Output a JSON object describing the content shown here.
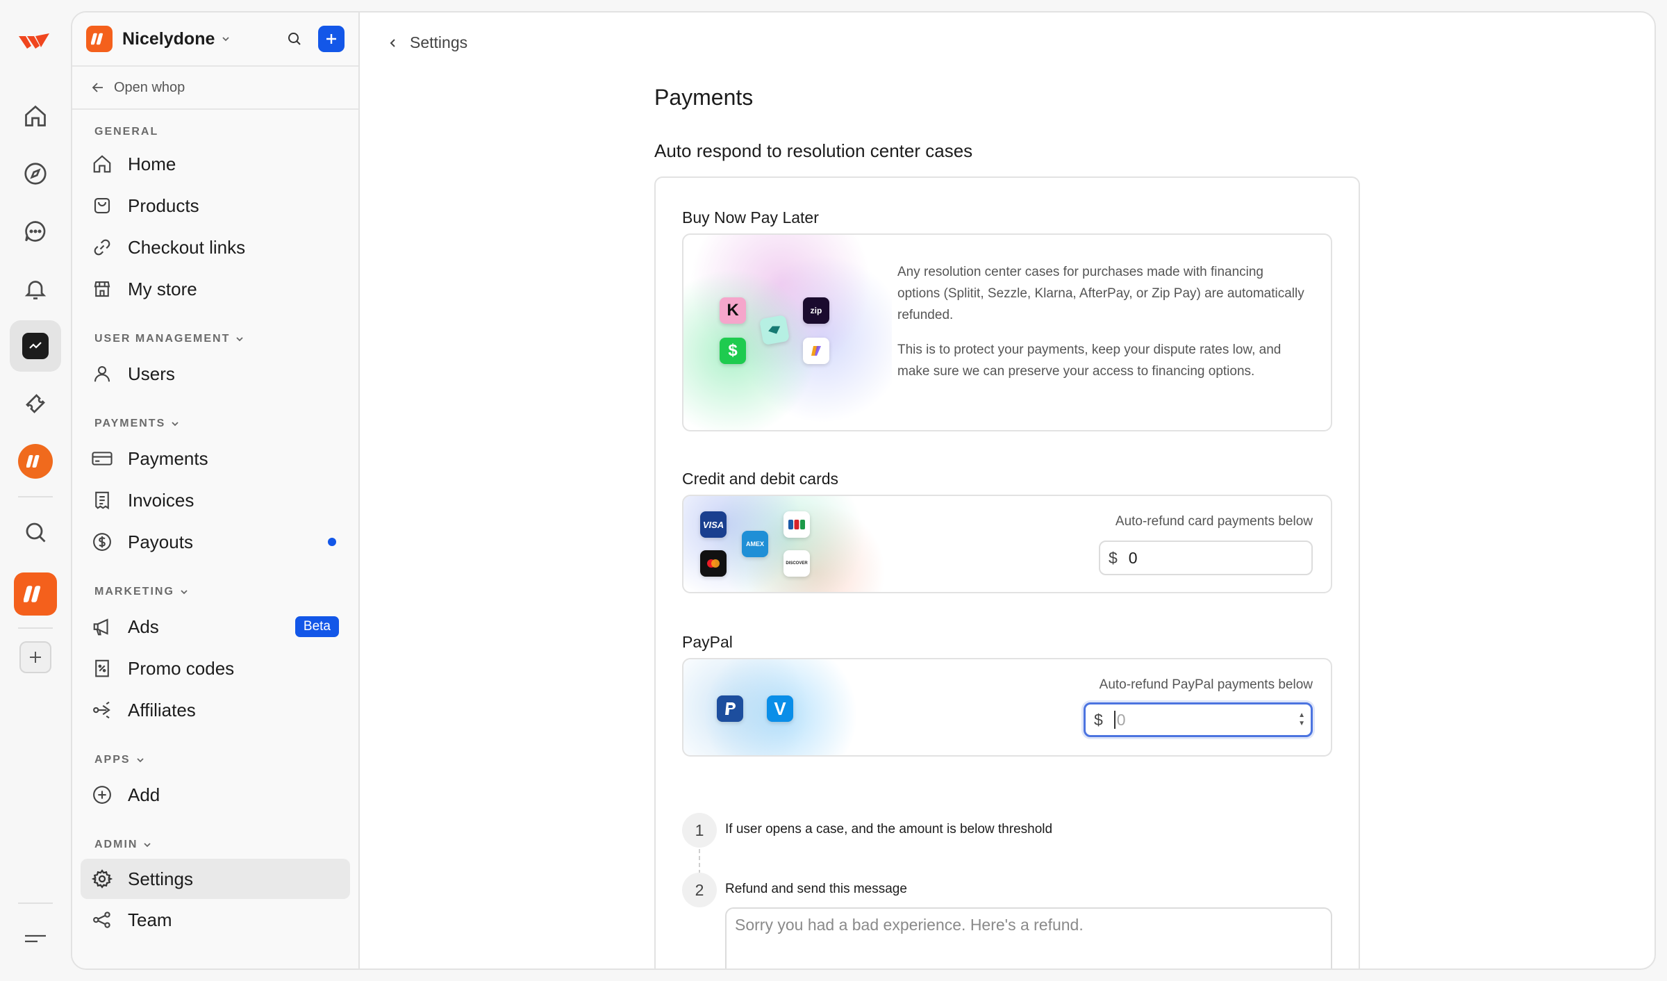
{
  "app": {
    "business_name": "Nicelydone",
    "open_whop": "Open whop"
  },
  "rail": {
    "icons": [
      "whop-logo-icon",
      "home-icon",
      "compass-icon",
      "chat-icon",
      "bell-icon",
      "dashboard-icon",
      "ticket-icon",
      "nicelydone-icon",
      "search-icon",
      "nicelydone-app-icon",
      "add-icon",
      "menu-icon"
    ]
  },
  "sidebar": {
    "sections": {
      "general": "GENERAL",
      "user_management": "USER MANAGEMENT",
      "payments": "PAYMENTS",
      "marketing": "MARKETING",
      "apps": "APPS",
      "admin": "ADMIN"
    },
    "items": {
      "home": "Home",
      "products": "Products",
      "checkout_links": "Checkout links",
      "my_store": "My store",
      "users": "Users",
      "payments": "Payments",
      "invoices": "Invoices",
      "payouts": "Payouts",
      "ads": "Ads",
      "ads_badge": "Beta",
      "promo_codes": "Promo codes",
      "affiliates": "Affiliates",
      "add": "Add",
      "settings": "Settings",
      "team": "Team"
    }
  },
  "main": {
    "breadcrumb": "Settings",
    "title": "Payments",
    "section_title": "Auto respond to resolution center cases",
    "bnpl": {
      "label": "Buy Now Pay Later",
      "text1": "Any resolution center cases for purchases made with financing options (Splitit, Sezzle, Klarna, AfterPay, or Zip Pay) are automatically refunded.",
      "text2": "This is to protect your payments, keep your dispute rates low, and make sure we can preserve your access to financing options.",
      "logos": [
        "klarna",
        "afterpay",
        "zip",
        "cash-app",
        "splitit"
      ]
    },
    "cards": {
      "label": "Credit and debit cards",
      "refund_label": "Auto-refund card payments below",
      "currency": "$",
      "value": "0",
      "logos": [
        "VISA",
        "AMEX",
        "JCB",
        "mastercard",
        "DISCOVER"
      ]
    },
    "paypal": {
      "label": "PayPal",
      "refund_label": "Auto-refund PayPal payments below",
      "currency": "$",
      "placeholder": "0",
      "logos": [
        "paypal",
        "venmo"
      ]
    },
    "steps": {
      "one_num": "1",
      "one_text": "If user opens a case, and the amount is below threshold",
      "two_num": "2",
      "two_text": "Refund and send this message"
    },
    "message_placeholder": "Sorry you had a bad experience. Here's a refund."
  },
  "colors": {
    "accent_blue": "#1357e8",
    "brand_orange": "#f4601c",
    "focus_ring": "#4c74e0"
  }
}
